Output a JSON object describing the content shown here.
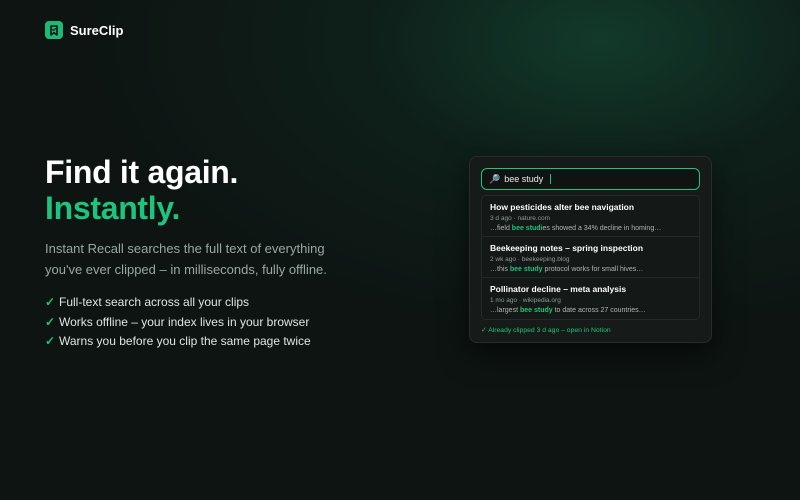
{
  "brand": {
    "name": "SureClip",
    "accent": "#1ec47c"
  },
  "hero": {
    "headline": "Find it again.",
    "headline_accent": "Instantly.",
    "lead": "Instant Recall searches the full text of everything you've ever clipped – in milliseconds, fully offline.",
    "features": [
      "Full-text search across all your clips",
      "Works offline – your index lives in your browser",
      "Warns you before you clip the same page twice"
    ]
  },
  "recall_panel": {
    "search_value": "bee study",
    "search_icon": "magnifier-icon",
    "results": [
      {
        "title": "How pesticides alter bee navigation",
        "meta": "3 d ago · nature.com",
        "snippet_pre": "…field ",
        "snippet_hl": "bee studi",
        "snippet_post": "es showed a 34% decline in homing…"
      },
      {
        "title": "Beekeeping notes – spring inspection",
        "meta": "2 wk ago · beekeeping.blog",
        "snippet_pre": "…this ",
        "snippet_hl": "bee study",
        "snippet_post": " protocol works for small hives…"
      },
      {
        "title": "Pollinator decline – meta analysis",
        "meta": "1 mo ago · wikipedia.org",
        "snippet_pre": "…largest ",
        "snippet_hl": "bee study",
        "snippet_post": " to date across 27 countries…"
      }
    ],
    "status": "✓ Already clipped 3 d ago – open in Notion"
  }
}
